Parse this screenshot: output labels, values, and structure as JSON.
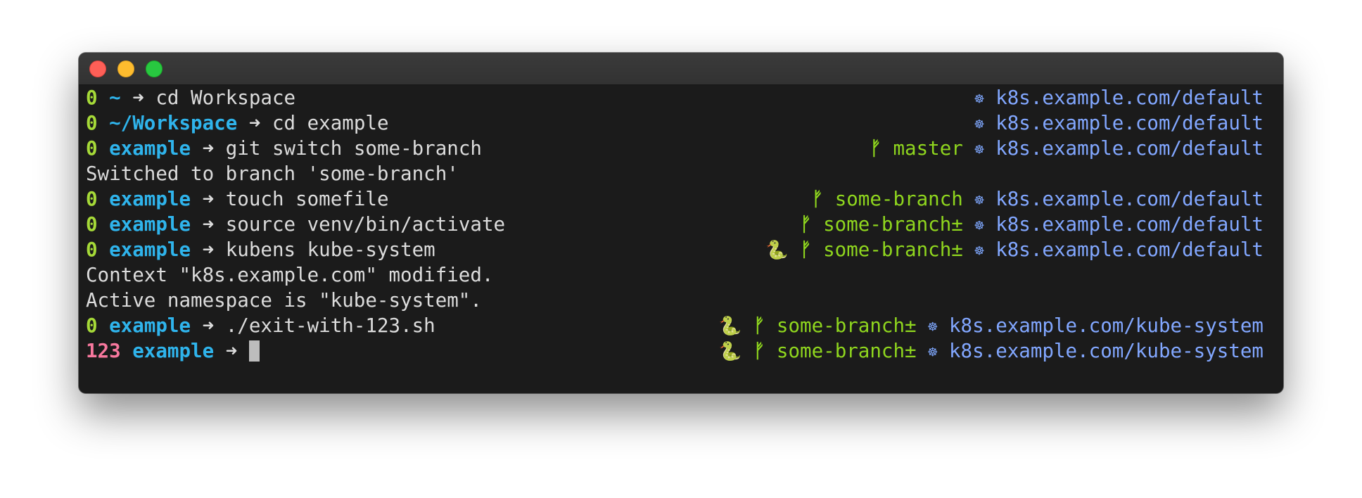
{
  "window": {
    "buttons": [
      "close",
      "minimize",
      "zoom"
    ]
  },
  "lines": [
    {
      "status": "0",
      "dir": "~",
      "arrow": "➜",
      "command": "cd Workspace",
      "venv": "",
      "branch_icon": "",
      "branch": "",
      "k8s_icon": "☸",
      "context": "k8s.example.com/default"
    },
    {
      "status": "0",
      "dir": "~/Workspace",
      "arrow": "➜",
      "command": "cd example",
      "venv": "",
      "branch_icon": "",
      "branch": "",
      "k8s_icon": "☸",
      "context": "k8s.example.com/default"
    },
    {
      "status": "0",
      "dir": "example",
      "arrow": "➜",
      "command": "git switch some-branch",
      "venv": "",
      "branch_icon": "ᚠ",
      "branch": "master",
      "k8s_icon": "☸",
      "context": "k8s.example.com/default"
    },
    {
      "output": "Switched to branch 'some-branch'"
    },
    {
      "status": "0",
      "dir": "example",
      "arrow": "➜",
      "command": "touch somefile",
      "venv": "",
      "branch_icon": "ᚠ",
      "branch": "some-branch",
      "k8s_icon": "☸",
      "context": "k8s.example.com/default"
    },
    {
      "status": "0",
      "dir": "example",
      "arrow": "➜",
      "command": "source venv/bin/activate",
      "venv": "",
      "branch_icon": "ᚠ",
      "branch": "some-branch±",
      "k8s_icon": "☸",
      "context": "k8s.example.com/default"
    },
    {
      "status": "0",
      "dir": "example",
      "arrow": "➜",
      "command": "kubens kube-system",
      "venv": "🐍",
      "branch_icon": "ᚠ",
      "branch": "some-branch±",
      "k8s_icon": "☸",
      "context": "k8s.example.com/default"
    },
    {
      "output": "Context \"k8s.example.com\" modified."
    },
    {
      "output": "Active namespace is \"kube-system\"."
    },
    {
      "status": "0",
      "dir": "example",
      "arrow": "➜",
      "command": "./exit-with-123.sh",
      "venv": "🐍",
      "branch_icon": "ᚠ",
      "branch": "some-branch±",
      "k8s_icon": "☸",
      "context": "k8s.example.com/kube-system"
    },
    {
      "status": "123",
      "status_error": true,
      "dir": "example",
      "arrow": "➜",
      "command": "",
      "cursor": true,
      "venv": "🐍",
      "branch_icon": "ᚠ",
      "branch": "some-branch±",
      "k8s_icon": "☸",
      "context": "k8s.example.com/kube-system"
    }
  ],
  "colors": {
    "status_ok": "#a6da38",
    "status_error": "#f8789e",
    "directory": "#2fb4ec",
    "branch": "#8fd61e",
    "kube_context": "#82a7ff",
    "background": "#1b1b1b"
  },
  "icons": {
    "branch": "git-branch-icon",
    "kube": "kubernetes-helm-icon",
    "venv": "python-snake-icon"
  }
}
